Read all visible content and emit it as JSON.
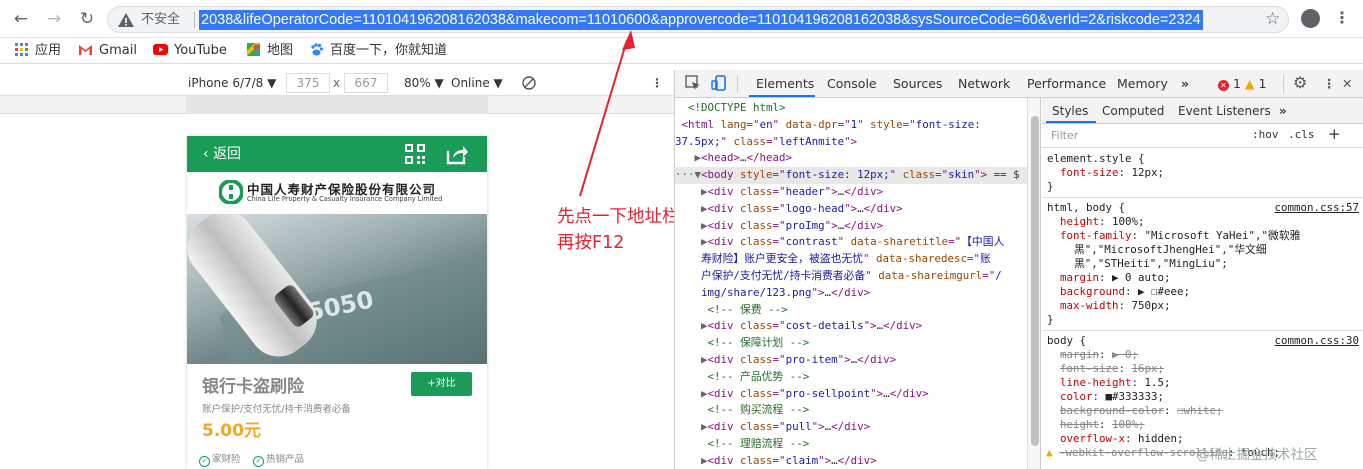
{
  "browser": {
    "insecure_label": "不安全",
    "url": "2038&lifeOperatorCode=110104196208162038&makecom=11010600&approvercode=110104196208162038&sysSourceCode=60&verId=2&riskcode=2324",
    "bookmarks": [
      {
        "label": "应用",
        "icon": "apps-grid-icon"
      },
      {
        "label": "Gmail",
        "icon": "gmail-icon"
      },
      {
        "label": "YouTube",
        "icon": "youtube-icon"
      },
      {
        "label": "地图",
        "icon": "maps-icon"
      },
      {
        "label": "百度一下，你就知道",
        "icon": "baidu-paw-icon"
      }
    ]
  },
  "device_toolbar": {
    "device": "iPhone 6/7/8 ▼",
    "width": "375",
    "x": "x",
    "height": "667",
    "zoom": "80% ▼",
    "network": "Online ▼"
  },
  "page": {
    "back_label": "返回",
    "logo_cn": "中国人寿财产保险股份有限公司",
    "logo_en": "China Life Property & Casualty Insurance Company Limited",
    "card_number": "5050",
    "title": "银行卡盗刷险",
    "compare_label": "+对比",
    "desc": "账户保护/支付无忧/持卡消费者必备",
    "price": "5.00元",
    "tags": [
      "家财险",
      "热销产品"
    ]
  },
  "annotation": {
    "line1": "先点一下地址栏",
    "line2": "再按F12"
  },
  "devtools": {
    "tabs": [
      "Elements",
      "Console",
      "Sources",
      "Network",
      "Performance",
      "Memory",
      "»"
    ],
    "errors": "1",
    "warnings": "1",
    "styles_tabs": [
      "Styles",
      "Computed",
      "Event Listeners",
      "»"
    ],
    "filter_placeholder": "Filter",
    "hov": ":hov",
    "cls": ".cls",
    "plus": "+"
  },
  "elements_lines": [
    {
      "indent": "  ",
      "parts": [
        [
          "cm",
          "<!DOCTYPE html>"
        ]
      ]
    },
    {
      "indent": " ",
      "parts": [
        [
          "tg",
          "<html "
        ],
        [
          "at",
          "lang"
        ],
        [
          "tg",
          "=\""
        ],
        [
          "av",
          "en"
        ],
        [
          "tg",
          "\" "
        ],
        [
          "at",
          "data-dpr"
        ],
        [
          "tg",
          "=\""
        ],
        [
          "av",
          "1"
        ],
        [
          "tg",
          "\" "
        ],
        [
          "at",
          "style"
        ],
        [
          "tg",
          "=\""
        ],
        [
          "av",
          "font-size:"
        ]
      ]
    },
    {
      "indent": "",
      "parts": [
        [
          "av",
          "37.5px;"
        ],
        [
          "tg",
          "\" "
        ],
        [
          "at",
          "class"
        ],
        [
          "tg",
          "=\""
        ],
        [
          "av",
          "leftAnmite"
        ],
        [
          "tg",
          "\">"
        ]
      ]
    },
    {
      "indent": "   ▶",
      "parts": [
        [
          "tg",
          "<head>"
        ],
        [
          "tx",
          "…"
        ],
        [
          "tg",
          "</head>"
        ]
      ]
    },
    {
      "indent": "···▼",
      "parts": [
        [
          "tg",
          "<body "
        ],
        [
          "at",
          "style"
        ],
        [
          "tg",
          "=\""
        ],
        [
          "av",
          "font-size: 12px;"
        ],
        [
          "tg",
          "\" "
        ],
        [
          "at",
          "class"
        ],
        [
          "tg",
          "=\""
        ],
        [
          "av",
          "skin"
        ],
        [
          "tg",
          "\">"
        ],
        [
          "tx",
          " == $"
        ]
      ]
    },
    {
      "indent": "    ▶",
      "parts": [
        [
          "tg",
          "<div "
        ],
        [
          "at",
          "class"
        ],
        [
          "tg",
          "=\""
        ],
        [
          "av",
          "header"
        ],
        [
          "tg",
          "\">"
        ],
        [
          "tx",
          "…"
        ],
        [
          "tg",
          "</div>"
        ]
      ]
    },
    {
      "indent": "    ▶",
      "parts": [
        [
          "tg",
          "<div "
        ],
        [
          "at",
          "class"
        ],
        [
          "tg",
          "=\""
        ],
        [
          "av",
          "logo-head"
        ],
        [
          "tg",
          "\">"
        ],
        [
          "tx",
          "…"
        ],
        [
          "tg",
          "</div>"
        ]
      ]
    },
    {
      "indent": "    ▶",
      "parts": [
        [
          "tg",
          "<div "
        ],
        [
          "at",
          "class"
        ],
        [
          "tg",
          "=\""
        ],
        [
          "av",
          "proImg"
        ],
        [
          "tg",
          "\">"
        ],
        [
          "tx",
          "…"
        ],
        [
          "tg",
          "</div>"
        ]
      ]
    },
    {
      "indent": "    ▶",
      "parts": [
        [
          "tg",
          "<div "
        ],
        [
          "at",
          "class"
        ],
        [
          "tg",
          "=\""
        ],
        [
          "av",
          "contrast"
        ],
        [
          "tg",
          "\" "
        ],
        [
          "at",
          "data-sharetitle"
        ],
        [
          "tg",
          "=\""
        ],
        [
          "av",
          "【中国人"
        ]
      ]
    },
    {
      "indent": "    ",
      "parts": [
        [
          "av",
          "寿财险】账户更安全，被盗也无忧"
        ],
        [
          "tg",
          "\" "
        ],
        [
          "at",
          "data-sharedesc"
        ],
        [
          "tg",
          "=\""
        ],
        [
          "av",
          "账"
        ]
      ]
    },
    {
      "indent": "    ",
      "parts": [
        [
          "av",
          "户保护/支付无忧/持卡消费者必备"
        ],
        [
          "tg",
          "\" "
        ],
        [
          "at",
          "data-shareimgurl"
        ],
        [
          "tg",
          "=\""
        ],
        [
          "av",
          "/"
        ]
      ]
    },
    {
      "indent": "    ",
      "parts": [
        [
          "av",
          "img/share/123.png"
        ],
        [
          "tg",
          "\">"
        ],
        [
          "tx",
          "…"
        ],
        [
          "tg",
          "</div>"
        ]
      ]
    },
    {
      "indent": "     ",
      "parts": [
        [
          "cm",
          "<!-- 保费 -->"
        ]
      ]
    },
    {
      "indent": "    ▶",
      "parts": [
        [
          "tg",
          "<div "
        ],
        [
          "at",
          "class"
        ],
        [
          "tg",
          "=\""
        ],
        [
          "av",
          "cost-details"
        ],
        [
          "tg",
          "\">"
        ],
        [
          "tx",
          "…"
        ],
        [
          "tg",
          "</div>"
        ]
      ]
    },
    {
      "indent": "     ",
      "parts": [
        [
          "cm",
          "<!-- 保障计划 -->"
        ]
      ]
    },
    {
      "indent": "    ▶",
      "parts": [
        [
          "tg",
          "<div "
        ],
        [
          "at",
          "class"
        ],
        [
          "tg",
          "=\""
        ],
        [
          "av",
          "pro-item"
        ],
        [
          "tg",
          "\">"
        ],
        [
          "tx",
          "…"
        ],
        [
          "tg",
          "</div>"
        ]
      ]
    },
    {
      "indent": "     ",
      "parts": [
        [
          "cm",
          "<!-- 产品优势 -->"
        ]
      ]
    },
    {
      "indent": "    ▶",
      "parts": [
        [
          "tg",
          "<div "
        ],
        [
          "at",
          "class"
        ],
        [
          "tg",
          "=\""
        ],
        [
          "av",
          "pro-sellpoint"
        ],
        [
          "tg",
          "\">"
        ],
        [
          "tx",
          "…"
        ],
        [
          "tg",
          "</div>"
        ]
      ]
    },
    {
      "indent": "     ",
      "parts": [
        [
          "cm",
          "<!-- 购买流程 -->"
        ]
      ]
    },
    {
      "indent": "    ▶",
      "parts": [
        [
          "tg",
          "<div "
        ],
        [
          "at",
          "class"
        ],
        [
          "tg",
          "=\""
        ],
        [
          "av",
          "pull"
        ],
        [
          "tg",
          "\">"
        ],
        [
          "tx",
          "…"
        ],
        [
          "tg",
          "</div>"
        ]
      ]
    },
    {
      "indent": "     ",
      "parts": [
        [
          "cm",
          "<!-- 理赔流程 -->"
        ]
      ]
    },
    {
      "indent": "    ▶",
      "parts": [
        [
          "tg",
          "<div "
        ],
        [
          "at",
          "class"
        ],
        [
          "tg",
          "=\""
        ],
        [
          "av",
          "claim"
        ],
        [
          "tg",
          "\">"
        ],
        [
          "tx",
          "…"
        ],
        [
          "tg",
          "</div>"
        ]
      ]
    }
  ],
  "styles_rules": [
    {
      "kind": "sel",
      "text": "element.style {"
    },
    {
      "kind": "prop",
      "name": "font-size",
      "value": "12px;"
    },
    {
      "kind": "close",
      "text": "}"
    },
    {
      "kind": "sep"
    },
    {
      "kind": "sel",
      "text": "html, body {",
      "source": "common.css:57"
    },
    {
      "kind": "prop",
      "name": "height",
      "value": "100%;"
    },
    {
      "kind": "prop",
      "name": "font-family",
      "value": "\"Microsoft YaHei\",\"微软雅"
    },
    {
      "kind": "cont",
      "value": "黑\",\"MicrosoftJhengHei\",\"华文细"
    },
    {
      "kind": "cont",
      "value": "黑\",\"STHeiti\",\"MingLiu\";"
    },
    {
      "kind": "prop",
      "name": "margin",
      "value": "▶ 0 auto;"
    },
    {
      "kind": "prop",
      "name": "background",
      "value": "▶ ☐#eee;"
    },
    {
      "kind": "prop",
      "name": "max-width",
      "value": "750px;"
    },
    {
      "kind": "close",
      "text": "}"
    },
    {
      "kind": "sep"
    },
    {
      "kind": "sel",
      "text": "body {",
      "source": "common.css:30"
    },
    {
      "kind": "strike",
      "name": "margin",
      "value": "▶ 0;"
    },
    {
      "kind": "strike",
      "name": "font-size",
      "value": "16px;"
    },
    {
      "kind": "prop",
      "name": "line-height",
      "value": "1.5;"
    },
    {
      "kind": "prop",
      "name": "color",
      "value": "■#333333;"
    },
    {
      "kind": "strike",
      "name": "background-color",
      "value": "☐white;"
    },
    {
      "kind": "strike",
      "name": "height",
      "value": "100%;"
    },
    {
      "kind": "prop",
      "name": "overflow-x",
      "value": "hidden;"
    },
    {
      "kind": "warn",
      "name": "-webkit-overflow-scrolling",
      "value": "touch;"
    }
  ],
  "watermark": "@稀土掘金技术社区"
}
